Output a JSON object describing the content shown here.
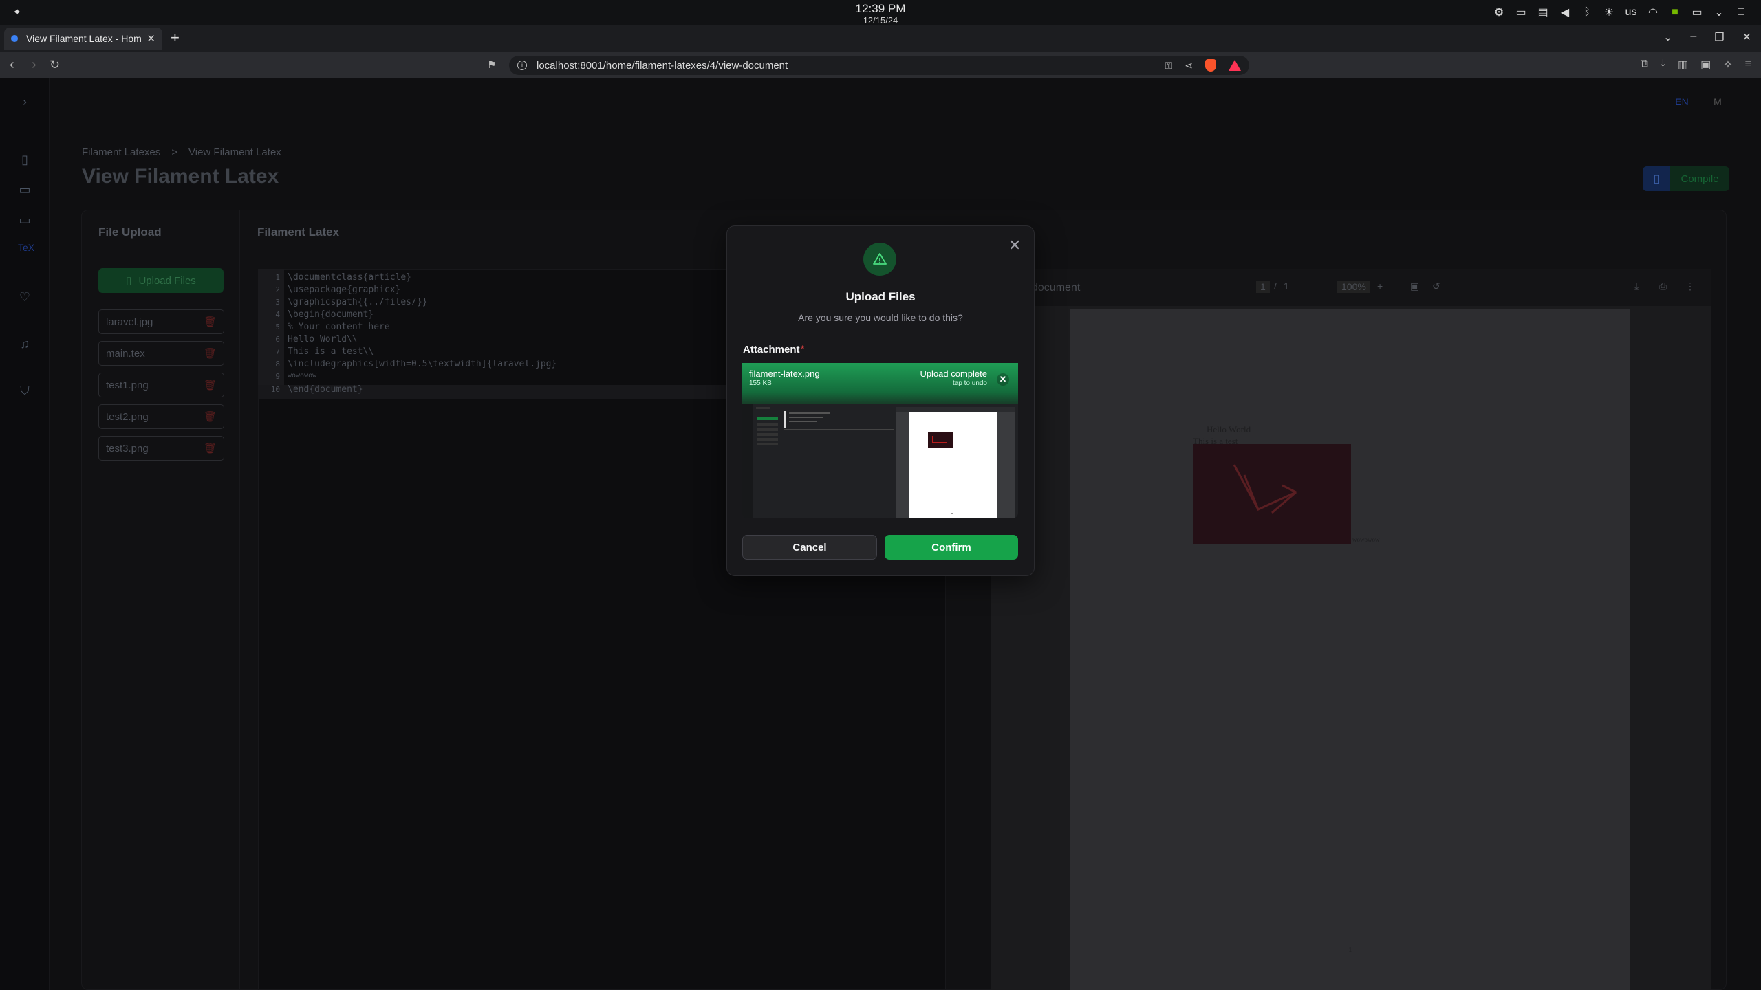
{
  "os": {
    "time": "12:39 PM",
    "date": "12/15/24",
    "keyboard_layout": "us"
  },
  "browser": {
    "tab_title": "View Filament Latex - Home",
    "new_tab": "+",
    "url": "localhost:8001/home/filament-latexes/4/view-document"
  },
  "app": {
    "lang": "EN",
    "avatar": "M",
    "breadcrumbs": [
      "Filament Latexes",
      "View Filament Latex"
    ],
    "breadcrumb_sep": ">",
    "page_title": "View Filament Latex",
    "compile_label": "Compile",
    "file_upload": {
      "title": "File Upload",
      "upload_button": "Upload Files",
      "files": [
        "laravel.jpg",
        "main.tex",
        "test1.png",
        "test2.png",
        "test3.png"
      ]
    },
    "latex": {
      "title": "Filament Latex",
      "line_numbers": [
        "1",
        "2",
        "3",
        "4",
        "5",
        "6",
        "7",
        "8",
        "9",
        "10"
      ],
      "lines": [
        "\\documentclass{article}",
        "\\usepackage{graphicx}",
        "\\graphicspath{{../files/}}",
        "\\begin{document}",
        "% Your content here",
        "Hello World\\\\",
        "This is a test\\\\",
        "\\includegraphics[width=0.5\\textwidth]{laravel.jpg}",
        "wowowow",
        "\\end{document}"
      ]
    },
    "pdf": {
      "name": "document",
      "page_current": "1",
      "page_sep": "/",
      "page_total": "1",
      "zoom": "100%",
      "text_line1": "Hello World",
      "text_line2": "This is a test",
      "image_caption": "wowowow",
      "page_number": "1"
    }
  },
  "modal": {
    "title": "Upload Files",
    "description": "Are you sure you would like to do this?",
    "attachment_label": "Attachment",
    "required_mark": "*",
    "file_name": "filament-latex.png",
    "file_size": "155 KB",
    "status": "Upload complete",
    "undo_hint": "tap to undo",
    "cancel_label": "Cancel",
    "confirm_label": "Confirm",
    "accent_color": "#16a34a"
  }
}
